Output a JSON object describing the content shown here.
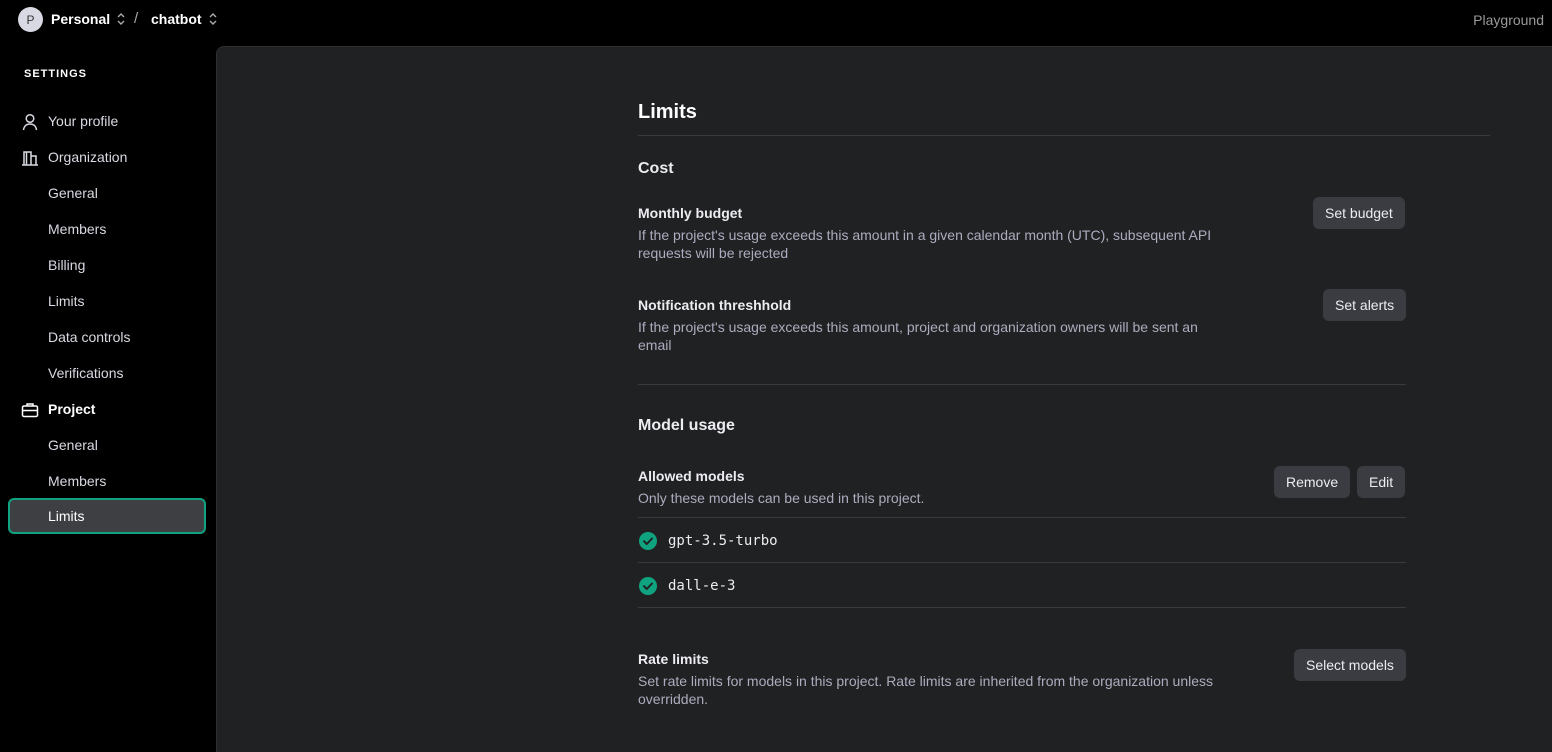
{
  "topbar": {
    "avatar_initial": "P",
    "org_name": "Personal",
    "separator": "/",
    "project_name": "chatbot",
    "playground_label": "Playground"
  },
  "sidebar": {
    "header": "SETTINGS",
    "items": [
      {
        "label": "Your profile",
        "icon": "person-icon"
      },
      {
        "label": "Organization",
        "icon": "building-icon"
      },
      {
        "label": "General"
      },
      {
        "label": "Members"
      },
      {
        "label": "Billing"
      },
      {
        "label": "Limits"
      },
      {
        "label": "Data controls"
      },
      {
        "label": "Verifications"
      },
      {
        "label": "Project",
        "icon": "briefcase-icon"
      },
      {
        "label": "General"
      },
      {
        "label": "Members"
      },
      {
        "label": "Limits",
        "selected": true
      }
    ]
  },
  "main": {
    "title": "Limits",
    "cost": {
      "title": "Cost",
      "monthly_budget": {
        "title": "Monthly budget",
        "desc": "If the project's usage exceeds this amount in a given calendar month (UTC), subsequent API requests will be rejected",
        "button": "Set budget"
      },
      "notification": {
        "title": "Notification threshhold",
        "desc": "If the project's usage exceeds this amount, project and organization owners will be sent an email",
        "button": "Set alerts"
      }
    },
    "model_usage": {
      "title": "Model usage",
      "allowed": {
        "title": "Allowed models",
        "desc": "Only these models can be used in this project.",
        "remove_button": "Remove",
        "edit_button": "Edit",
        "models": [
          "gpt-3.5-turbo",
          "dall-e-3"
        ]
      },
      "rate_limits": {
        "title": "Rate limits",
        "desc": "Set rate limits for models in this project. Rate limits are inherited from the organization unless overridden.",
        "button": "Select models"
      }
    }
  },
  "colors": {
    "accent": "#10a37f",
    "panel_bg": "#202123",
    "button_bg": "#3b3c41"
  }
}
